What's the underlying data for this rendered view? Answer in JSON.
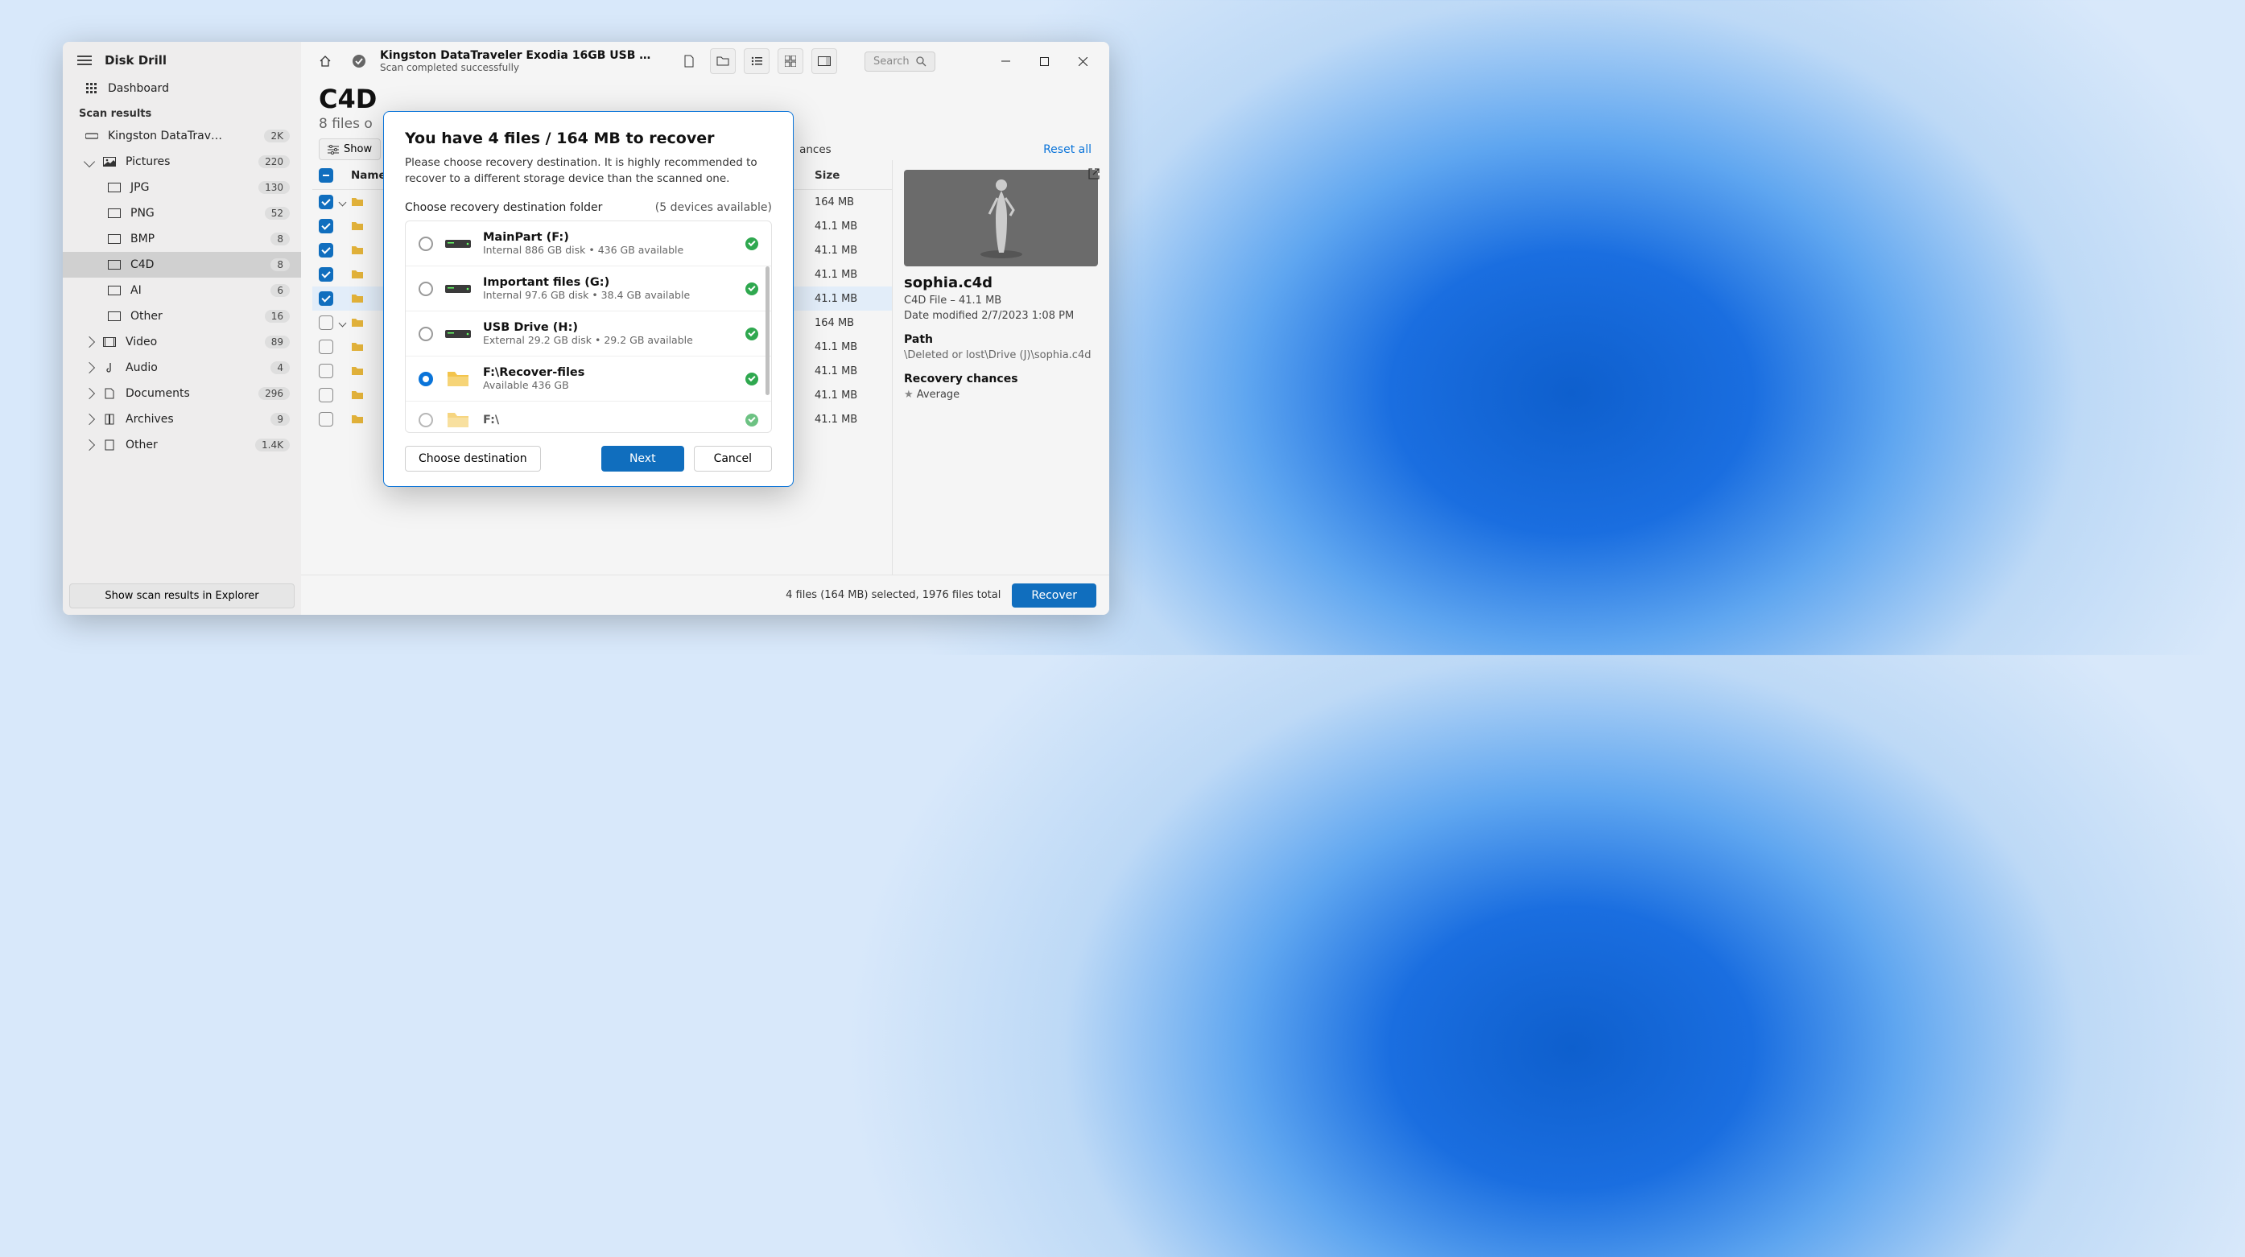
{
  "app_title": "Disk Drill",
  "sidebar": {
    "dashboard": "Dashboard",
    "section": "Scan results",
    "device": {
      "label": "Kingston DataTraveler Ex...",
      "count": "2K"
    },
    "pictures": {
      "label": "Pictures",
      "count": "220"
    },
    "jpg": {
      "label": "JPG",
      "count": "130"
    },
    "png": {
      "label": "PNG",
      "count": "52"
    },
    "bmp": {
      "label": "BMP",
      "count": "8"
    },
    "c4d": {
      "label": "C4D",
      "count": "8"
    },
    "ai": {
      "label": "AI",
      "count": "6"
    },
    "other_pic": {
      "label": "Other",
      "count": "16"
    },
    "video": {
      "label": "Video",
      "count": "89"
    },
    "audio": {
      "label": "Audio",
      "count": "4"
    },
    "documents": {
      "label": "Documents",
      "count": "296"
    },
    "archives": {
      "label": "Archives",
      "count": "9"
    },
    "other": {
      "label": "Other",
      "count": "1.4K"
    },
    "footer_btn": "Show scan results in Explorer"
  },
  "toolbar": {
    "device_title": "Kingston DataTraveler Exodia 16GB USB 3.2 Flash...",
    "status": "Scan completed successfully",
    "search_placeholder": "Search"
  },
  "content": {
    "folder_title": "C4D",
    "folder_sub": "8 files o",
    "filter_toggle": "Show",
    "chances": "ances",
    "reset": "Reset all"
  },
  "table": {
    "name_header": "Name",
    "size_header": "Size",
    "rows": [
      {
        "checked": true,
        "size": "164 MB"
      },
      {
        "checked": true,
        "size": "41.1 MB"
      },
      {
        "checked": true,
        "size": "41.1 MB"
      },
      {
        "checked": true,
        "size": "41.1 MB"
      },
      {
        "checked": true,
        "size": "41.1 MB",
        "sel": true
      },
      {
        "checked": false,
        "size": "164 MB"
      },
      {
        "checked": false,
        "size": "41.1 MB"
      },
      {
        "checked": false,
        "size": "41.1 MB"
      },
      {
        "checked": false,
        "size": "41.1 MB"
      },
      {
        "checked": false,
        "size": "41.1 MB"
      }
    ]
  },
  "detail": {
    "filename": "sophia.c4d",
    "meta": "C4D File – 41.1 MB",
    "modified": "Date modified 2/7/2023 1:08 PM",
    "path_h": "Path",
    "path": "\\Deleted or lost\\Drive (J)\\sophia.c4d",
    "chances_h": "Recovery chances",
    "chances": "Average"
  },
  "footer": {
    "summary": "4 files (164 MB) selected, 1976 files total",
    "recover": "Recover"
  },
  "modal": {
    "title": "You have 4 files / 164 MB to recover",
    "desc": "Please choose recovery destination. It is highly recommended to recover to a different storage device than the scanned one.",
    "sub_head": "Choose recovery destination folder",
    "dev_count": "(5 devices available)",
    "destinations": [
      {
        "name": "MainPart (F:)",
        "sub": "Internal 886 GB disk • 436 GB available",
        "type": "drive",
        "selected": false
      },
      {
        "name": "Important files (G:)",
        "sub": "Internal 97.6 GB disk • 38.4 GB available",
        "type": "drive",
        "selected": false
      },
      {
        "name": "USB Drive (H:)",
        "sub": "External 29.2 GB disk • 29.2 GB available",
        "type": "drive",
        "selected": false
      },
      {
        "name": "F:\\Recover-files",
        "sub": "Available 436 GB",
        "type": "folder",
        "selected": true
      },
      {
        "name": "F:\\",
        "sub": "",
        "type": "folder",
        "selected": false
      }
    ],
    "choose_btn": "Choose destination",
    "next_btn": "Next",
    "cancel_btn": "Cancel"
  }
}
